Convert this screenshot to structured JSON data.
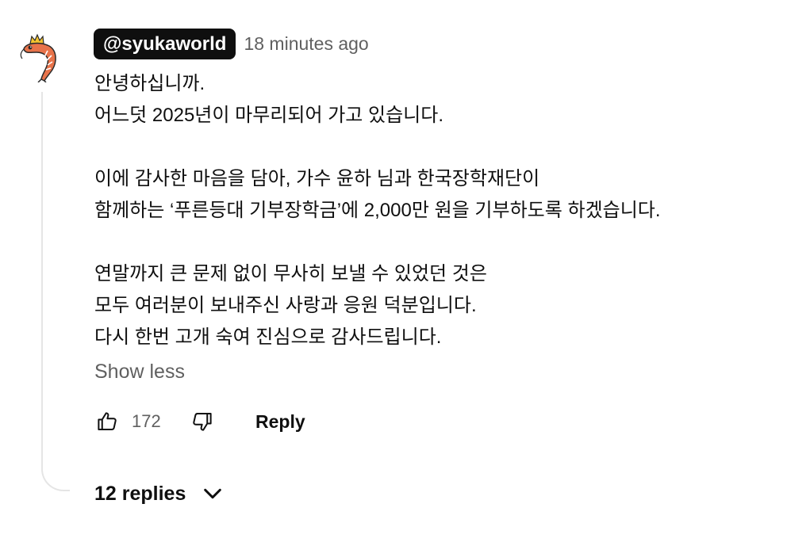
{
  "comment": {
    "author": "@syukaworld",
    "timestamp": "18 minutes ago",
    "body_lines": [
      "안녕하십니까.",
      "어느덧 2025년이 마무리되어 가고 있습니다.",
      "",
      "이에 감사한 마음을 담아, 가수 윤하 님과 한국장학재단이",
      "함께하는 ‘푸른등대 기부장학금’에 2,000만 원을 기부하도록 하겠습니다.",
      "",
      "연말까지 큰 문제 없이 무사히 보낼 수 있었던 것은",
      "모두 여러분이 보내주신 사랑과 응원 덕분입니다.",
      "다시 한번 고개 숙여 진심으로 감사드립니다."
    ],
    "show_less_label": "Show less",
    "like_count": "172",
    "reply_label": "Reply",
    "replies_label": "12 replies"
  },
  "icons": {
    "avatar": "shrimp-avatar",
    "like": "thumbs-up-icon",
    "dislike": "thumbs-down-icon",
    "expand": "chevron-down-icon"
  },
  "colors": {
    "author_badge_bg": "#0f0f0f",
    "author_badge_text": "#ffffff",
    "secondary_text": "#606060",
    "primary_text": "#0f0f0f",
    "thread_line": "#e5e5e5",
    "avatar_shrimp": "#e8734a"
  }
}
